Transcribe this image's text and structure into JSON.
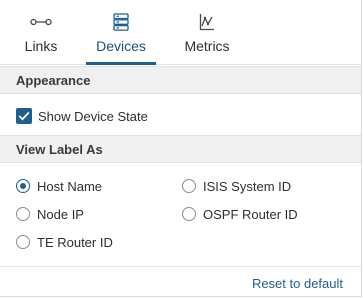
{
  "tabs": [
    {
      "label": "Links",
      "icon": "links-icon",
      "active": false
    },
    {
      "label": "Devices",
      "icon": "devices-icon",
      "active": true
    },
    {
      "label": "Metrics",
      "icon": "metrics-icon",
      "active": false
    }
  ],
  "appearance": {
    "header": "Appearance",
    "show_device_state": {
      "label": "Show Device State",
      "checked": true
    }
  },
  "view_label": {
    "header": "View Label As",
    "selected": "Host Name",
    "options": [
      {
        "label": "Host Name",
        "selected": true
      },
      {
        "label": "ISIS System ID",
        "selected": false
      },
      {
        "label": "Node IP",
        "selected": false
      },
      {
        "label": "OSPF Router ID",
        "selected": false
      },
      {
        "label": "TE Router ID",
        "selected": false
      }
    ]
  },
  "footer": {
    "reset_label": "Reset to default"
  },
  "colors": {
    "accent": "#1f5f8f",
    "section_bg": "#f0f0f0"
  }
}
